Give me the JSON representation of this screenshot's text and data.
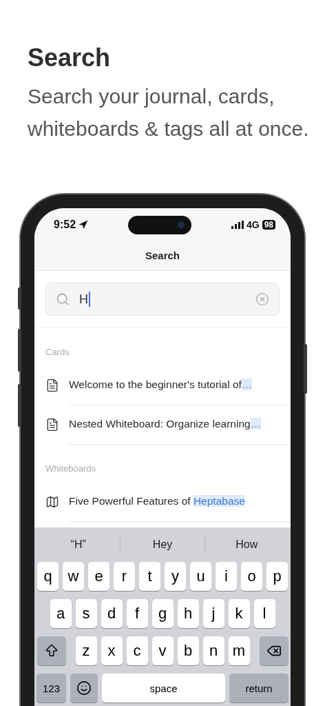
{
  "heading": {
    "title": "Search",
    "subtitle": "Search your journal, cards, whiteboards & tags all at once."
  },
  "status_bar": {
    "time": "9:52",
    "network": "4G",
    "battery": "98"
  },
  "nav": {
    "title": "Search"
  },
  "search": {
    "value": "H"
  },
  "sections": [
    {
      "title": "Cards",
      "items": [
        {
          "kind": "card",
          "parts": [
            {
              "text": "Welcome to the beginner's tutorial of",
              "highlight": false
            },
            {
              "text": "…",
              "highlight": true
            }
          ]
        },
        {
          "kind": "card",
          "parts": [
            {
              "text": "Nested Whiteboard: Organize learning",
              "highlight": false
            },
            {
              "text": "…",
              "highlight": true
            }
          ]
        }
      ]
    },
    {
      "title": "Whiteboards",
      "items": [
        {
          "kind": "whiteboard",
          "parts": [
            {
              "text": "Five Powerful Features of ",
              "highlight": false
            },
            {
              "text": "Heptabase",
              "highlight": true
            }
          ]
        }
      ]
    }
  ],
  "keyboard": {
    "suggestions": [
      "“H”",
      "Hey",
      "How"
    ],
    "key_rows": [
      {
        "keys": [
          {
            "kind": "letter",
            "label": "q"
          },
          {
            "kind": "letter",
            "label": "w"
          },
          {
            "kind": "letter",
            "label": "e"
          },
          {
            "kind": "letter",
            "label": "r"
          },
          {
            "kind": "letter",
            "label": "t"
          },
          {
            "kind": "letter",
            "label": "y"
          },
          {
            "kind": "letter",
            "label": "u"
          },
          {
            "kind": "letter",
            "label": "i"
          },
          {
            "kind": "letter",
            "label": "o"
          },
          {
            "kind": "letter",
            "label": "p"
          }
        ]
      },
      {
        "keys": [
          {
            "kind": "letter",
            "label": "a"
          },
          {
            "kind": "letter",
            "label": "s"
          },
          {
            "kind": "letter",
            "label": "d"
          },
          {
            "kind": "letter",
            "label": "f"
          },
          {
            "kind": "letter",
            "label": "g"
          },
          {
            "kind": "letter",
            "label": "h"
          },
          {
            "kind": "letter",
            "label": "j"
          },
          {
            "kind": "letter",
            "label": "k"
          },
          {
            "kind": "letter",
            "label": "l"
          }
        ]
      },
      {
        "keys": [
          {
            "kind": "shift"
          },
          {
            "kind": "letter",
            "label": "z"
          },
          {
            "kind": "letter",
            "label": "x"
          },
          {
            "kind": "letter",
            "label": "c"
          },
          {
            "kind": "letter",
            "label": "v"
          },
          {
            "kind": "letter",
            "label": "b"
          },
          {
            "kind": "letter",
            "label": "n"
          },
          {
            "kind": "letter",
            "label": "m"
          },
          {
            "kind": "delete"
          }
        ]
      },
      {
        "keys": [
          {
            "kind": "mode",
            "label": "123"
          },
          {
            "kind": "emoji"
          },
          {
            "kind": "space",
            "label": "space"
          },
          {
            "kind": "return",
            "label": "return"
          }
        ]
      }
    ]
  }
}
